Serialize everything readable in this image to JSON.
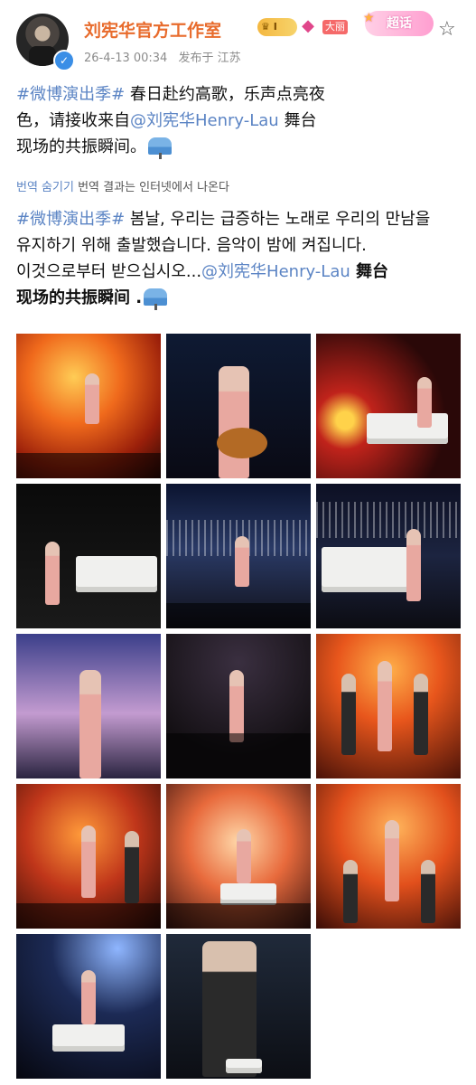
{
  "header": {
    "username": "刘宪华官方工作室",
    "level_badge": "I",
    "big_badge": "大丽",
    "supertopic_label": "超话",
    "timestamp": "26-4-13 00:34",
    "publish_location": "发布于 江苏"
  },
  "post": {
    "hashtag": "#微博演出季#",
    "text_line1": " 春日赴约高歌，乐声点亮夜",
    "text_line2": "色，请接收来自",
    "mention": "@刘宪华Henry-Lau",
    "text_line2b": " 舞台",
    "text_line3": "现场的共振瞬间。"
  },
  "translation": {
    "hide_label": "번역 숨기기",
    "note": " 번역 결과는 인터넷에서 나온다",
    "hashtag": "#微博演出季#",
    "line1": " 봄날, 우리는 급증하는 노래로 우리의 만남을",
    "line2": "유지하기 위해 출발했습니다. 음악이 밤에 켜집니다.",
    "line3_pre": "이것으로부터 받으십시오...",
    "mention": "@刘宪华Henry-Lau",
    "line3_post": " 舞台",
    "line4": "现场的共振瞬间 ."
  },
  "photos": [
    {
      "bg": "radial-gradient(circle at 40% 30%, #ffcc55 0%, #f06a1c 35%, #9a1f0a 70%, #2a0905 100%)"
    },
    {
      "bg": "linear-gradient(180deg, #0e1a33 0%, #0a0a14 100%)"
    },
    {
      "bg": "radial-gradient(circle at 20% 60%, #ffd24a 0 6%, #c0231b 20%, #2a0808 70%)"
    },
    {
      "bg": "linear-gradient(180deg, #0a0a0a 0%, #1a1a1a 100%)"
    },
    {
      "bg": "linear-gradient(180deg, #0b1430 0%, #2a3a66 45%, #101018 100%)"
    },
    {
      "bg": "linear-gradient(180deg, #0d1024 0%, #1c2440 50%, #0c0c12 100%)"
    },
    {
      "bg": "linear-gradient(180deg, #3b3f8a 0%, #c39bd0 55%, #2a2440 100%)"
    },
    {
      "bg": "radial-gradient(circle at 50% 20%, #3a2f40 0%, #141014 70%)"
    },
    {
      "bg": "radial-gradient(circle at 50% 25%, #ffb04a 0%, #e8561c 40%, #4a1208 100%)"
    },
    {
      "bg": "radial-gradient(circle at 45% 35%, #ff9a3a 0%, #c0361a 45%, #2a0a06 100%)"
    },
    {
      "bg": "radial-gradient(circle at 50% 40%, #ffd7a8 0%, #e86a3c 45%, #3a1410 100%)"
    },
    {
      "bg": "radial-gradient(circle at 55% 30%, #ffb35a 0%, #e2501c 45%, #3a0c06 100%)"
    },
    {
      "bg": "radial-gradient(circle at 70% 10%, #8fb6ff 0%, #1c2a55 40%, #06070f 100%)"
    },
    {
      "bg": "linear-gradient(180deg, #202a3a 0%, #0c0e14 100%)"
    }
  ]
}
